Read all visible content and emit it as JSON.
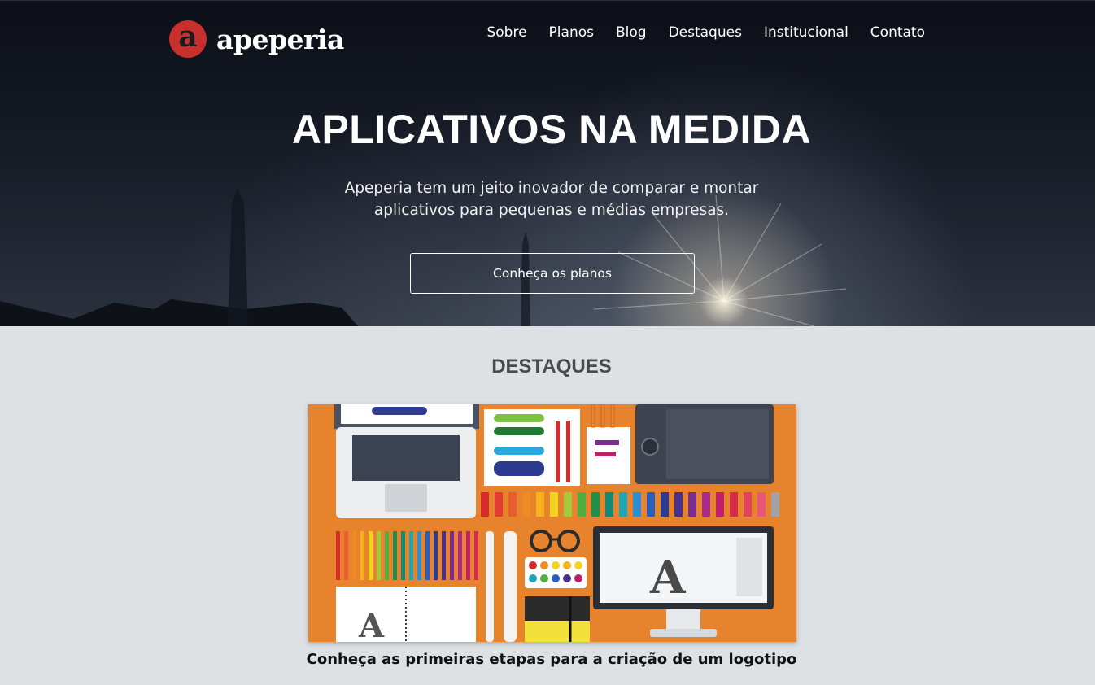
{
  "brand": {
    "logo_letter": "a",
    "name": "apeperia",
    "mark_color": "#c8302e"
  },
  "nav": {
    "items": [
      {
        "label": "Sobre"
      },
      {
        "label": "Planos"
      },
      {
        "label": "Blog"
      },
      {
        "label": "Destaques"
      },
      {
        "label": "Institucional"
      },
      {
        "label": "Contato"
      }
    ]
  },
  "hero": {
    "title": "APLICATIVOS NA MEDIDA",
    "subtitle": "Apeperia tem um jeito inovador de comparar e montar aplicativos para pequenas e médias empresas.",
    "cta_label": "Conheça os planos"
  },
  "highlights": {
    "title": "DESTAQUES",
    "card": {
      "caption": "Conheça as primeiras etapas para a criação de um logotipo",
      "image_bg": "#e8832d"
    }
  }
}
